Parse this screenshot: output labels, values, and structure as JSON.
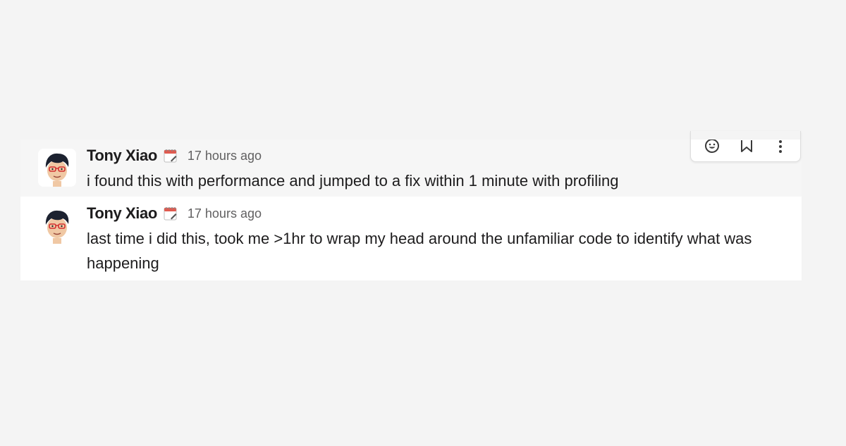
{
  "messages": [
    {
      "author": "Tony Xiao",
      "status_icon": "calendar-icon",
      "timestamp": "17 hours ago",
      "text": "i found this with performance and jumped to a fix within 1 minute with profiling"
    },
    {
      "author": "Tony Xiao",
      "status_icon": "calendar-icon",
      "timestamp": "17 hours ago",
      "text": "last time i did this, took me >1hr to wrap my head around the unfamiliar code to identify what was happening"
    }
  ],
  "hover_toolbar": {
    "buttons": [
      "add-reaction-icon",
      "bookmark-icon",
      "more-actions-icon"
    ]
  },
  "colors": {
    "page_background": "#f4f4f4",
    "message_hover_background": "#f6f6f6",
    "message_background": "#ffffff",
    "text": "#1d1c1d",
    "timestamp": "#616061"
  }
}
